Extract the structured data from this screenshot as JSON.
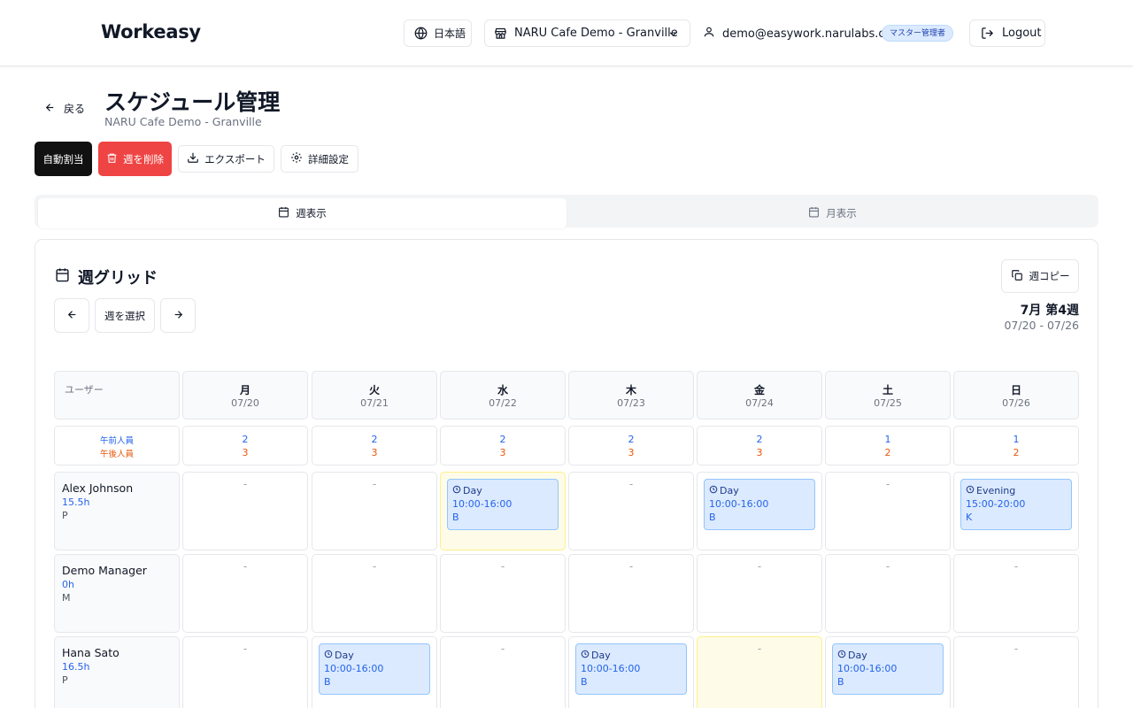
{
  "header": {
    "brand": "Workeasy",
    "language_label": "日本語",
    "store_label": "NARU Cafe Demo - Granville",
    "user_email": "demo@easywork.narulabs.ca",
    "role_badge": "マスター管理者",
    "logout_label": "Logout"
  },
  "page": {
    "back_label": "戻る",
    "title": "スケジュール管理",
    "subtitle": "NARU Cafe Demo - Granville"
  },
  "actions": {
    "auto_assign": "自動割当",
    "delete_week": "週を削除",
    "export": "エクスポート",
    "settings": "詳細設定"
  },
  "tabs": {
    "week": "週表示",
    "month": "月表示"
  },
  "grid": {
    "title": "週グリッド",
    "copy_week": "週コピー",
    "select_week": "週を選択",
    "week_label": "7月 第4週",
    "week_range": "07/20 - 07/26",
    "user_column": "ユーザー",
    "am_label": "午前人員",
    "pm_label": "午後人員",
    "empty": "-",
    "days": [
      {
        "name": "月",
        "date": "07/20",
        "am": "2",
        "pm": "3"
      },
      {
        "name": "火",
        "date": "07/21",
        "am": "2",
        "pm": "3"
      },
      {
        "name": "水",
        "date": "07/22",
        "am": "2",
        "pm": "3"
      },
      {
        "name": "木",
        "date": "07/23",
        "am": "2",
        "pm": "3"
      },
      {
        "name": "金",
        "date": "07/24",
        "am": "2",
        "pm": "3"
      },
      {
        "name": "土",
        "date": "07/25",
        "am": "1",
        "pm": "2"
      },
      {
        "name": "日",
        "date": "07/26",
        "am": "1",
        "pm": "2"
      }
    ],
    "users": [
      {
        "name": "Alex Johnson",
        "hours": "15.5h",
        "role": "P",
        "cells": [
          null,
          null,
          {
            "shift": "Day",
            "time": "10:00-16:00",
            "code": "B"
          },
          null,
          {
            "shift": "Day",
            "time": "10:00-16:00",
            "code": "B"
          },
          null,
          {
            "shift": "Evening",
            "time": "15:00-20:00",
            "code": "K"
          }
        ]
      },
      {
        "name": "Demo Manager",
        "hours": "0h",
        "role": "M",
        "cells": [
          null,
          null,
          null,
          null,
          null,
          null,
          null
        ]
      },
      {
        "name": "Hana Sato",
        "hours": "16.5h",
        "role": "P",
        "cells": [
          null,
          {
            "shift": "Day",
            "time": "10:00-16:00",
            "code": "B"
          },
          null,
          {
            "shift": "Day",
            "time": "10:00-16:00",
            "code": "B"
          },
          null,
          {
            "shift": "Day",
            "time": "10:00-16:00",
            "code": "B"
          },
          null
        ]
      }
    ]
  },
  "icons": {
    "globe": "globe-icon",
    "store": "store-icon",
    "chevron": "chevron-down-icon",
    "user": "user-icon",
    "logout": "logout-icon",
    "back": "arrow-left-icon",
    "trash": "trash-icon",
    "download": "download-icon",
    "gear": "gear-icon",
    "calendar": "calendar-icon",
    "copy": "copy-icon",
    "clock": "clock-icon"
  },
  "colors": {
    "primary": "#111111",
    "danger": "#ef4444",
    "am": "#2563eb",
    "pm": "#ea580c",
    "shift_bg": "#dbeafe",
    "highlight": "#fefce8"
  }
}
